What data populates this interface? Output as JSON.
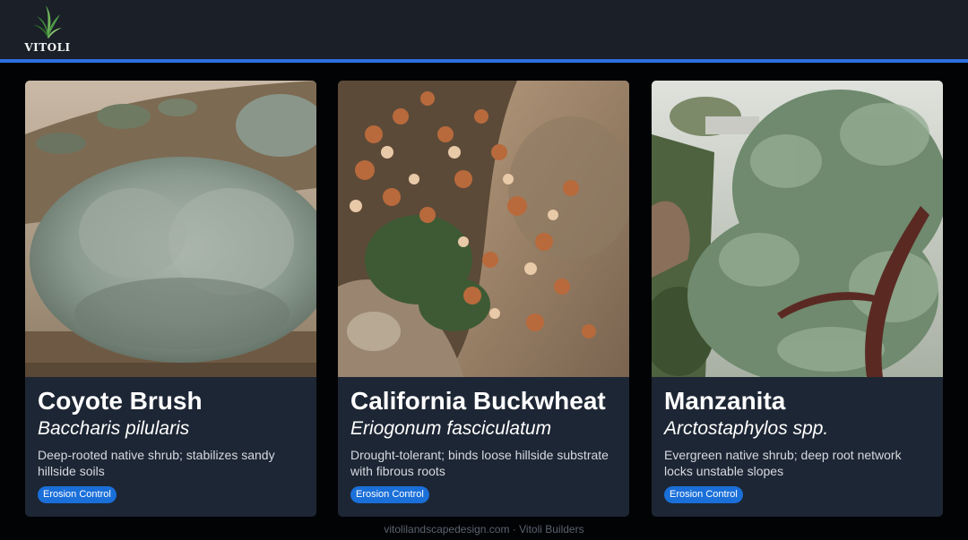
{
  "brand": {
    "logo_icon": "leaf-sprig-icon",
    "name": "VITOLI",
    "accent_color": "#2f6fe0"
  },
  "cards": [
    {
      "image": "coyote-brush-photo",
      "title": "Coyote Brush",
      "scientific_name": "Baccharis pilularis",
      "description": "Deep-rooted native shrub; stabilizes sandy hillside soils",
      "badge": "Erosion Control"
    },
    {
      "image": "california-buckwheat-photo",
      "title": "California Buckwheat",
      "scientific_name": "Eriogonum fasciculatum",
      "description": "Drought-tolerant; binds loose hillside substrate with fibrous roots",
      "badge": "Erosion Control"
    },
    {
      "image": "manzanita-photo",
      "title": "Manzanita",
      "scientific_name": "Arctostaphylos spp.",
      "description": "Evergreen native shrub; deep root network locks unstable slopes",
      "badge": "Erosion Control"
    }
  ],
  "footer": {
    "text": "vitolilandscapedesign.com · Vitoli Builders"
  },
  "colors": {
    "header_bg": "#1a1f28",
    "card_bg": "#1d2634",
    "badge_bg": "#1a6fd9"
  }
}
